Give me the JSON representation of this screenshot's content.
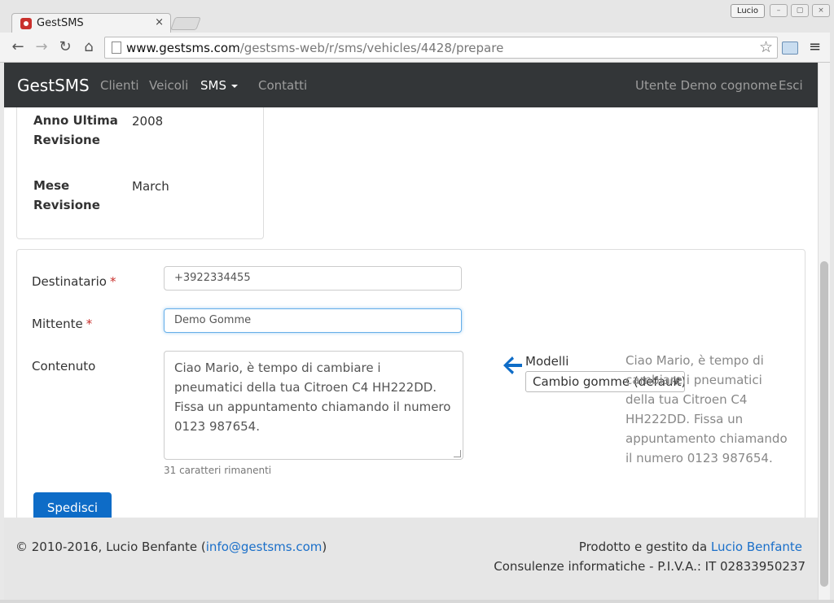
{
  "browser": {
    "tab_title": "GestSMS",
    "tab_close": "×",
    "user_badge": "Lucio",
    "url_host": "www.gestsms.com",
    "url_path": "/gestsms-web/r/sms/vehicles/4428/prepare",
    "back_glyph": "←",
    "forward_glyph": "→",
    "reload_glyph": "↻",
    "home_glyph": "⌂",
    "star_glyph": "☆",
    "menu_glyph": "≡",
    "min_glyph": "–",
    "max_glyph": "▢",
    "close_glyph": "×"
  },
  "navbar": {
    "brand": "GestSMS",
    "items": [
      "Clienti",
      "Veicoli",
      "SMS",
      "Contatti"
    ],
    "user": "Utente Demo cognome",
    "logout": "Esci"
  },
  "vehicle_info": {
    "anno_label": "Anno Ultima Revisione",
    "anno_value": "2008",
    "mese_label": "Mese Revisione",
    "mese_value": "March"
  },
  "form": {
    "destinatario_label": "Destinatario",
    "destinatario_value": "+3922334455",
    "mittente_label": "Mittente",
    "mittente_value": "Demo Gomme",
    "required_mark": "*",
    "contenuto_label": "Contenuto",
    "contenuto_value": "Ciao Mario, è tempo di cambiare i pneumatici della tua Citroen C4 HH222DD. Fissa un appuntamento chiamando il numero 0123 987654.",
    "remaining": "31 caratteri rimanenti",
    "send": "Spedisci",
    "models_label": "Modelli",
    "models_selected": "Cambio gomme (default)",
    "preview": "Ciao Mario, è tempo di cambiare i pneumatici della tua Citroen C4 HH222DD. Fissa un appuntamento chiamando il numero 0123 987654."
  },
  "footer": {
    "copyright_prefix": "© 2010-2016, Lucio Benfante (",
    "email": "info@gestsms.com",
    "copyright_suffix": ")",
    "produced_by": "Prodotto e gestito da",
    "author": "Lucio Benfante",
    "company": "Consulenze informatiche - P.I.V.A.: IT 02833950237"
  },
  "colors": {
    "navbar_bg": "#333638",
    "primary": "#0e6cc7",
    "link": "#1a6fc9",
    "required": "#c9302c"
  }
}
